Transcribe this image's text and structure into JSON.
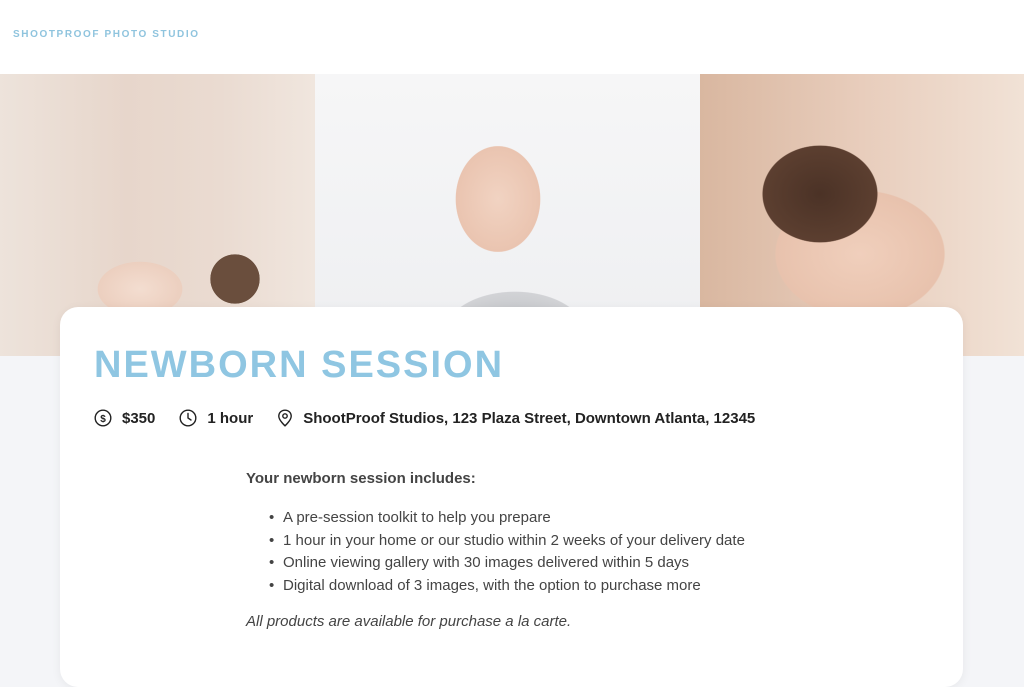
{
  "header": {
    "brand": "SHOOTPROOF PHOTO STUDIO"
  },
  "session": {
    "title": "NEWBORN SESSION",
    "price": "$350",
    "duration": "1 hour",
    "location": "ShootProof Studios, 123 Plaza Street, Downtown Atlanta, 12345"
  },
  "details": {
    "heading": "Your newborn session includes:",
    "items": [
      "A pre-session toolkit to help you prepare",
      "1 hour in your home or our studio within 2 weeks of your delivery date",
      "Online viewing gallery with 30 images delivered within 5 days",
      "Digital download of 3 images, with the option to purchase more"
    ],
    "note": "All products are available for purchase a la carte."
  },
  "icons": {
    "price": "dollar-circle-icon",
    "duration": "clock-icon",
    "location": "map-pin-icon"
  },
  "colors": {
    "accent": "#8fc6e2",
    "background": "#f4f5f8",
    "card": "#ffffff"
  }
}
